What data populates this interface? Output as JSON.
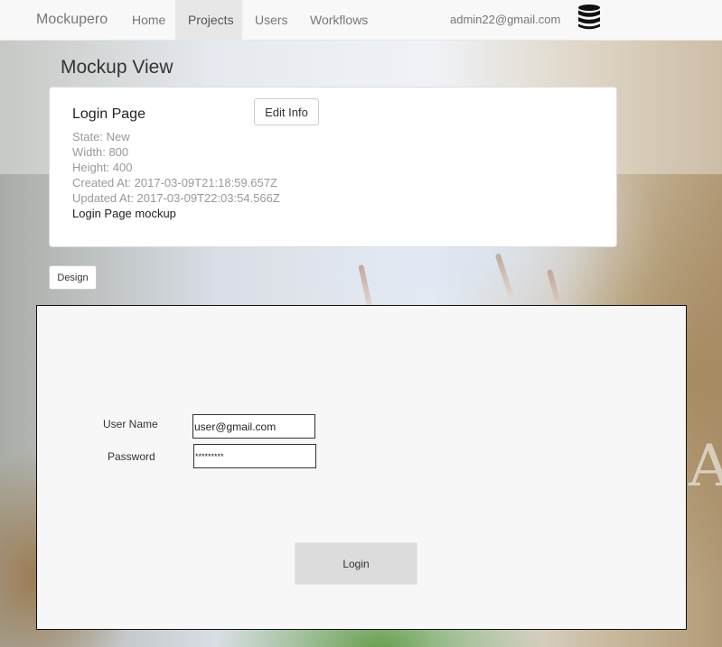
{
  "navbar": {
    "brand": "Mockupero",
    "links": [
      {
        "label": "Home"
      },
      {
        "label": "Projects",
        "active": true
      },
      {
        "label": "Users"
      },
      {
        "label": "Workflows"
      }
    ],
    "user_email": "admin22@gmail.com",
    "db_icon": "database-icon"
  },
  "page": {
    "title": "Mockup View"
  },
  "mockup": {
    "name": "Login Page",
    "edit_label": "Edit Info",
    "state": "State: New",
    "width": "Width: 800",
    "height": "Height: 400",
    "created": "Created At: 2017-03-09T21:18:59.657Z",
    "updated": "Updated At: 2017-03-09T22:03:54.566Z",
    "description": "Login Page mockup"
  },
  "design_button": "Design",
  "preview": {
    "username_label": "User Name",
    "username_value": "user@gmail.com",
    "password_label": "Password",
    "password_value": "*********",
    "login_label": "Login"
  },
  "colors": {
    "navbar_bg": "#f8f8f8",
    "canvas_bg": "#f7f7f7",
    "login_button_bg": "#dcdcdc"
  }
}
